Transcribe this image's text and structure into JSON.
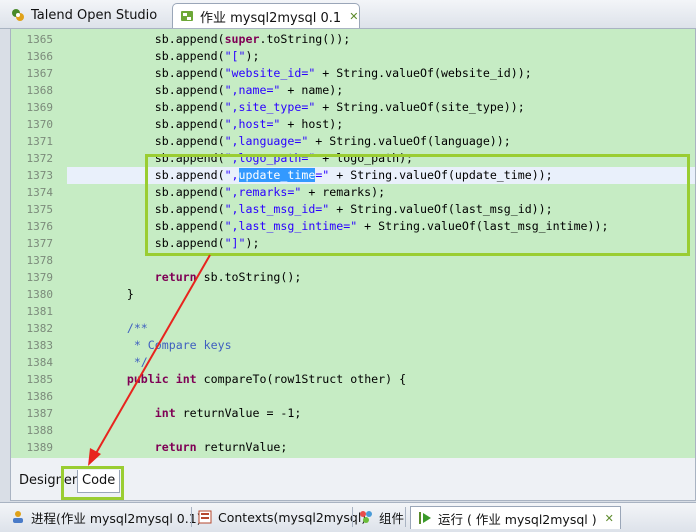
{
  "top_tabs": {
    "studio": "Talend Open Studio",
    "job": "作业 mysql2mysql 0.1"
  },
  "code_lines": [
    {
      "n": "1365",
      "segs": [
        [
          "            sb.append(",
          ""
        ],
        [
          "super",
          "kw"
        ],
        [
          ".toString());",
          ""
        ]
      ]
    },
    {
      "n": "1366",
      "segs": [
        [
          "            sb.append(",
          ""
        ],
        [
          "\"[\"",
          "str"
        ],
        [
          ");",
          ""
        ]
      ]
    },
    {
      "n": "1367",
      "segs": [
        [
          "            sb.append(",
          ""
        ],
        [
          "\"website_id=\"",
          "str"
        ],
        [
          " + String.valueOf(website_id));",
          ""
        ]
      ]
    },
    {
      "n": "1368",
      "segs": [
        [
          "            sb.append(",
          ""
        ],
        [
          "\",name=\"",
          "str"
        ],
        [
          " + name);",
          ""
        ]
      ]
    },
    {
      "n": "1369",
      "segs": [
        [
          "            sb.append(",
          ""
        ],
        [
          "\",site_type=\"",
          "str"
        ],
        [
          " + String.valueOf(site_type));",
          ""
        ]
      ]
    },
    {
      "n": "1370",
      "segs": [
        [
          "            sb.append(",
          ""
        ],
        [
          "\",host=\"",
          "str"
        ],
        [
          " + host);",
          ""
        ]
      ]
    },
    {
      "n": "1371",
      "segs": [
        [
          "            sb.append(",
          ""
        ],
        [
          "\",language=\"",
          "str"
        ],
        [
          " + String.valueOf(language));",
          ""
        ]
      ]
    },
    {
      "n": "1372",
      "segs": [
        [
          "            sb.append(",
          ""
        ],
        [
          "\",logo_path=\"",
          "str"
        ],
        [
          " + logo_path);",
          ""
        ]
      ]
    },
    {
      "n": "1373",
      "cur": true,
      "segs": [
        [
          "            sb.append(",
          ""
        ],
        [
          "\",",
          "str"
        ],
        [
          "update_time",
          "sel"
        ],
        [
          "=\"",
          "str"
        ],
        [
          " + String.valueOf(update_time));",
          ""
        ]
      ]
    },
    {
      "n": "1374",
      "segs": [
        [
          "            sb.append(",
          ""
        ],
        [
          "\",remarks=\"",
          "str"
        ],
        [
          " + remarks);",
          ""
        ]
      ]
    },
    {
      "n": "1375",
      "segs": [
        [
          "            sb.append(",
          ""
        ],
        [
          "\",last_msg_id=\"",
          "str"
        ],
        [
          " + String.valueOf(last_msg_id));",
          ""
        ]
      ]
    },
    {
      "n": "1376",
      "segs": [
        [
          "            sb.append(",
          ""
        ],
        [
          "\",last_msg_intime=\"",
          "str"
        ],
        [
          " + String.valueOf(last_msg_intime));",
          ""
        ]
      ]
    },
    {
      "n": "1377",
      "segs": [
        [
          "            sb.append(",
          ""
        ],
        [
          "\"]\"",
          "str"
        ],
        [
          ");",
          ""
        ]
      ]
    },
    {
      "n": "1378",
      "segs": []
    },
    {
      "n": "1379",
      "segs": [
        [
          "            ",
          ""
        ],
        [
          "return",
          "kw"
        ],
        [
          " sb.toString();",
          ""
        ]
      ]
    },
    {
      "n": "1380",
      "segs": [
        [
          "        }",
          ""
        ]
      ]
    },
    {
      "n": "1381",
      "segs": []
    },
    {
      "n": "1382",
      "segs": [
        [
          "        ",
          ""
        ],
        [
          "/**",
          "cm"
        ]
      ]
    },
    {
      "n": "1383",
      "segs": [
        [
          "         ",
          ""
        ],
        [
          "* Compare keys",
          "cm"
        ]
      ]
    },
    {
      "n": "1384",
      "segs": [
        [
          "         ",
          ""
        ],
        [
          "*/",
          "cm"
        ]
      ]
    },
    {
      "n": "1385",
      "segs": [
        [
          "        ",
          ""
        ],
        [
          "public",
          "kw"
        ],
        [
          " ",
          ""
        ],
        [
          "int",
          "kw"
        ],
        [
          " compareTo(row1Struct other) {",
          ""
        ]
      ]
    },
    {
      "n": "1386",
      "segs": []
    },
    {
      "n": "1387",
      "segs": [
        [
          "            ",
          ""
        ],
        [
          "int",
          "kw"
        ],
        [
          " returnValue = -1;",
          ""
        ]
      ]
    },
    {
      "n": "1388",
      "segs": []
    },
    {
      "n": "1389",
      "segs": [
        [
          "            ",
          ""
        ],
        [
          "return",
          "kw"
        ],
        [
          " returnValue;",
          ""
        ]
      ]
    }
  ],
  "editor_tabs": {
    "designer": "Designer",
    "code": "Code"
  },
  "bottom_tabs": {
    "process": "进程(作业 mysql2mysql 0.1)",
    "contexts": "Contexts(mysql2mysql)",
    "components": "组件",
    "run": "运行 ( 作业 mysql2mysql )"
  },
  "colors": {
    "editor_bg": "#c6ecc4",
    "highlight_box": "#9acd32",
    "arrow": "#e8241e",
    "selection": "#3399ff"
  }
}
